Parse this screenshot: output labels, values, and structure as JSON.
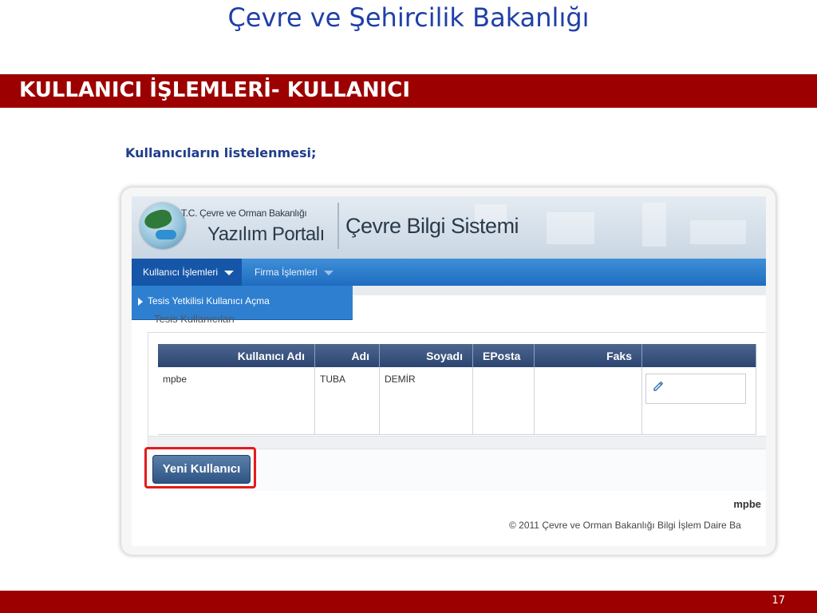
{
  "slide": {
    "title": "Çevre ve Şehircilik Bakanlığı",
    "section_heading": "KULLANICI İŞLEMLERİ- KULLANICI",
    "subtitle": "Kullanıcıların listelenmesi;",
    "page_number": "17",
    "colors": {
      "title": "#1f3fa8",
      "band": "#9c0000"
    }
  },
  "app": {
    "org_name": "T.C. Çevre ve Orman Bakanlığı",
    "portal_name": "Yazılım Portalı",
    "system_name": "Çevre Bilgi Sistemi",
    "nav": {
      "items": [
        {
          "label": "Kullanıcı İşlemleri",
          "icon": "chevron-down-icon",
          "active": true
        },
        {
          "label": "Firma İşlemleri",
          "icon": "chevron-down-icon",
          "active": false
        }
      ],
      "dropdown_item": "Tesis Yetkilisi Kullanıcı Açma"
    },
    "section_label": "Tesis Kullanıcıları",
    "table": {
      "headers": [
        "Kullanıcı Adı",
        "Adı",
        "Soyadı",
        "EPosta",
        "Faks",
        ""
      ],
      "rows": [
        {
          "username": "mpbe",
          "first_name": "TUBA",
          "last_name": "DEMİR",
          "email": "",
          "fax": "",
          "action_icon": "edit-icon"
        }
      ]
    },
    "new_user_button": "Yeni Kullanıcı",
    "logged_user": "mpbe",
    "footer": "© 2011 Çevre ve Orman Bakanlığı Bilgi İşlem Daire Ba"
  }
}
